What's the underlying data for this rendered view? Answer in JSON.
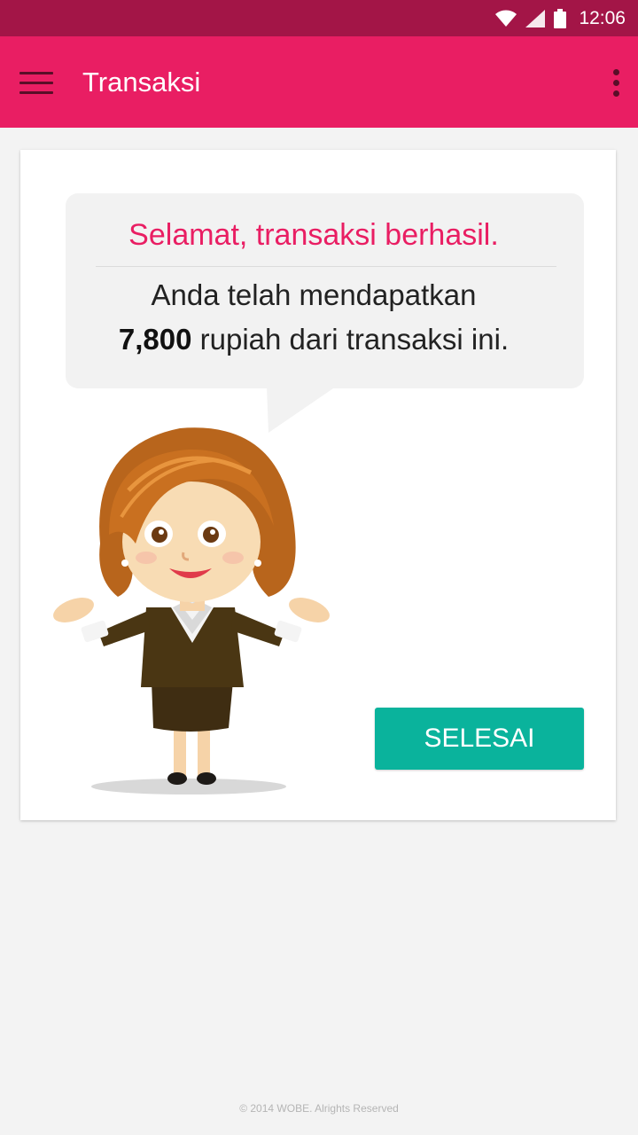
{
  "status_bar": {
    "time": "12:06",
    "icons": [
      "wifi-icon",
      "cell-signal-icon",
      "battery-icon"
    ],
    "color": "#a31547"
  },
  "app_bar": {
    "title": "Transaksi",
    "menu_icon": "hamburger-menu-icon",
    "overflow_icon": "more-vert-icon",
    "color": "#e91e63"
  },
  "card": {
    "bubble": {
      "title": "Selamat, transaksi berhasil.",
      "line1": "Anda telah mendapatkan",
      "amount": "7,800",
      "line2_suffix": " rupiah dari transaksi ini."
    },
    "mascot": "businesswoman-mascot-illustration",
    "button_label": "SELESAI",
    "button_color": "#0ab39c"
  },
  "footer": {
    "text": "© 2014 WOBE. Alrights Reserved"
  }
}
